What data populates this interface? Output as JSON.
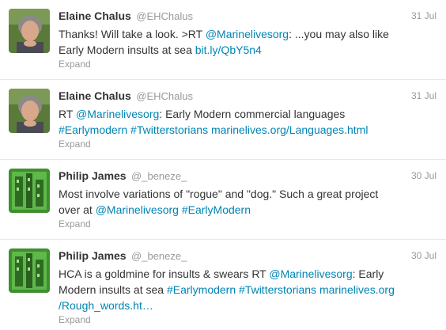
{
  "tweets": [
    {
      "fullname": "Elaine Chalus",
      "username": "@EHChalus",
      "time": "31 Jul",
      "line1_a": "Thanks! Will take a look. >RT ",
      "line1_link": "@Marinelivesorg",
      "line1_b": ": ...you may also like",
      "line2_a": "Early Modern insults at sea ",
      "line2_link": "bit.ly/QbY5n4",
      "expand": "Expand"
    },
    {
      "fullname": "Elaine Chalus",
      "username": "@EHChalus",
      "time": "31 Jul",
      "line1_a": "RT ",
      "line1_link": "@Marinelivesorg",
      "line1_b": ": Early Modern commercial languages",
      "line2_link1": "#Earlymodern",
      "line2_link2": "#Twitterstorians",
      "line2_link3": "marinelives.org/Languages.html",
      "expand": "Expand"
    },
    {
      "fullname": "Philip James",
      "username": "@_beneze_",
      "time": "30 Jul",
      "line1": "Most involve variations of \"rogue\" and \"dog.\" Such a great project",
      "line2_a": "over at ",
      "line2_link1": "@Marinelivesorg",
      "line2_link2": "#EarlyModern",
      "expand": "Expand"
    },
    {
      "fullname": "Philip James",
      "username": "@_beneze_",
      "time": "30 Jul",
      "line1_a": "HCA is a goldmine for insults & swears RT ",
      "line1_link": "@Marinelivesorg",
      "line1_b": ": Early",
      "line2_a": "Modern insults at sea ",
      "line2_link1": "#Earlymodern",
      "line2_link2": "#Twitterstorians",
      "line2_link3": "marinelives.org",
      "line3_link": "/Rough_words.ht…",
      "expand": "Expand"
    }
  ],
  "colors": {
    "link": "#0084b4",
    "muted": "#999999",
    "text": "#333333"
  }
}
